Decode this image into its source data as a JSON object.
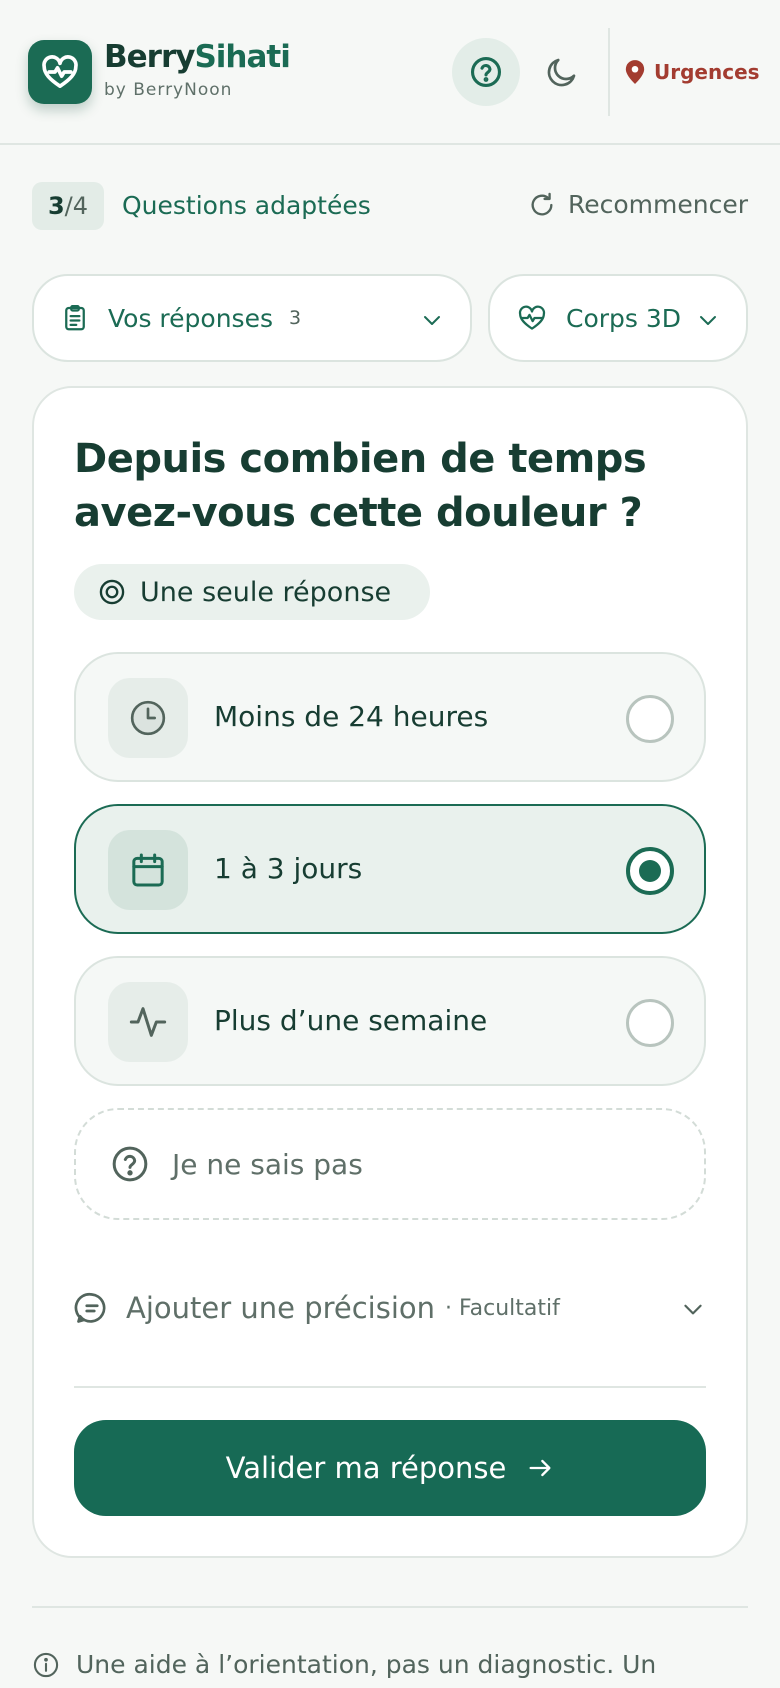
{
  "header": {
    "brand_part1": "Berry",
    "brand_part2": "Sihati",
    "brand_sub": "by BerryNoon",
    "urgences_label": "Urgences"
  },
  "progress": {
    "current": "3",
    "separator_total": "/4",
    "label": "Questions adaptées",
    "restart_label": "Recommencer"
  },
  "pills": {
    "answers_label": "Vos réponses",
    "answers_count": "3",
    "body_label": "Corps 3D"
  },
  "question": {
    "title": "Depuis combien de temps avez-vous cette douleur ?",
    "hint": "Une seule réponse",
    "options": [
      {
        "label": "Moins de 24 heures",
        "icon": "clock-icon",
        "selected": false
      },
      {
        "label": "1 à 3 jours",
        "icon": "calendar-icon",
        "selected": true
      },
      {
        "label": "Plus d’une semaine",
        "icon": "activity-icon",
        "selected": false
      }
    ],
    "unknown_label": "Je ne sais pas",
    "precision_label": "Ajouter une précision",
    "precision_optional": "· Facultatif",
    "submit_label": "Valider ma réponse"
  },
  "footer": {
    "disclaimer": "Une aide à l’orientation, pas un diagnostic. Un"
  },
  "colors": {
    "brand": "#1b6b54",
    "urgent": "#a33c30",
    "background": "#f6f8f6"
  }
}
